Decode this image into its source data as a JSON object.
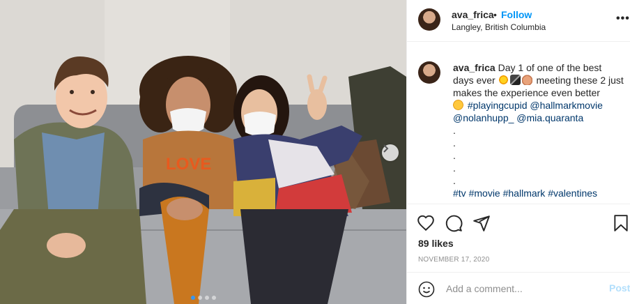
{
  "post": {
    "username": "ava_frica",
    "separator": "•",
    "follow_label": "Follow",
    "location": "Langley, British Columbia",
    "more_label": "•••"
  },
  "caption": {
    "username": "ava_frica",
    "text_1": "Day 1 of one of the best days ever",
    "emojis_1": [
      "collision-emoji",
      "clapper-board-emoji",
      "fist-bump-emoji"
    ],
    "text_2": "meeting these 2 just makes the experience even better",
    "emoji_2": "hugging-face-emoji",
    "tags_1": [
      "#playingcupid",
      "@hallmarkmovie",
      "@nolanhupp_",
      "@mia.quaranta"
    ],
    "dots": [
      ".",
      ".",
      ".",
      ".",
      "."
    ],
    "tags_2": [
      "#tv",
      "#movie",
      "#hallmark",
      "#valentines"
    ]
  },
  "actions": {
    "icons": [
      "heart-icon",
      "comment-icon",
      "share-icon",
      "bookmark-icon"
    ],
    "likes": "89 likes",
    "date": "NOVEMBER 17, 2020"
  },
  "comment": {
    "placeholder": "Add a comment...",
    "post_label": "Post"
  },
  "carousel": {
    "slide_count": 4,
    "active_index": 0,
    "next_icon": "chevron-right-icon"
  },
  "colors": {
    "follow": "#0095f6",
    "tag": "#00376b",
    "post_disabled": "#b2dffc",
    "muted": "#8e8e8e",
    "dot_active": "#3897f0"
  },
  "photo": {
    "sweater_text": "LOVE"
  }
}
